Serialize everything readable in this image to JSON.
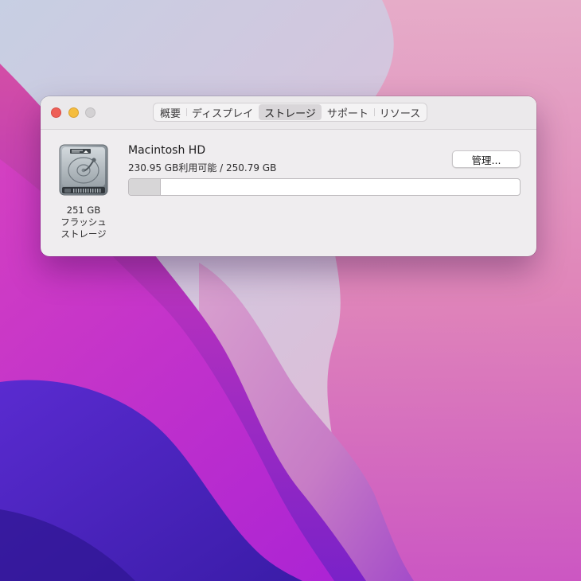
{
  "window": {
    "tabs": [
      {
        "label": "概要"
      },
      {
        "label": "ディスプレイ"
      },
      {
        "label": "ストレージ",
        "selected": true
      },
      {
        "label": "サポート"
      },
      {
        "label": "リソース"
      }
    ]
  },
  "storage": {
    "drive": {
      "capacity": "251 GB",
      "type_line1": "フラッシュ",
      "type_line2": "ストレージ",
      "icon": "hard-drive-icon"
    },
    "volume": {
      "name": "Macintosh HD",
      "info": "230.95 GB利用可能 / 250.79 GB",
      "available_gb": 230.95,
      "total_gb": 250.79
    },
    "manage_label": "管理...",
    "usage_fraction": 0.079
  },
  "colors": {
    "close": "#ee5f57",
    "minimize": "#f5bd3e",
    "zoom_disabled": "#d3d1d3",
    "usage_fill": "#d7d6d7"
  }
}
